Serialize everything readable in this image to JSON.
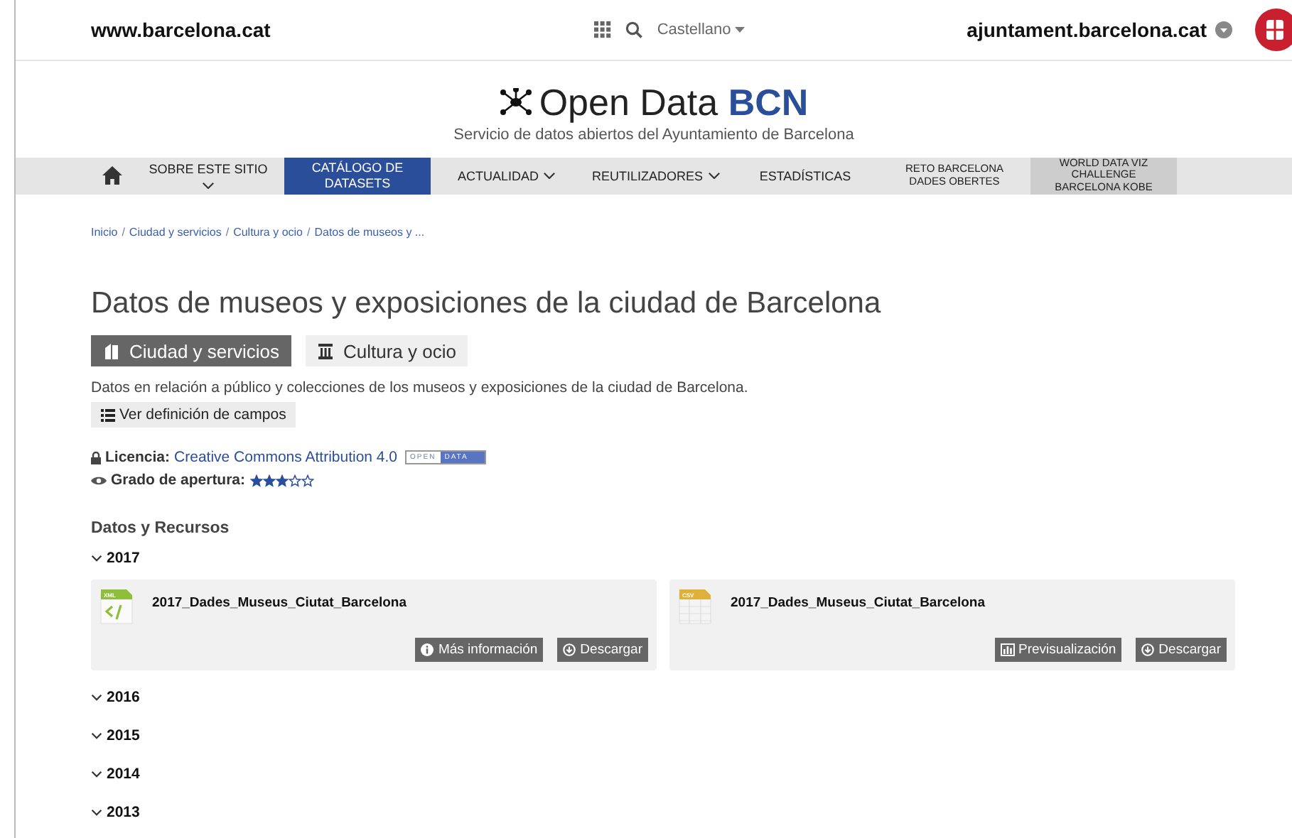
{
  "top_bar": {
    "site": "www.barcelona.cat",
    "language": "Castellano",
    "council": "ajuntament.barcelona.cat"
  },
  "logo": {
    "name": "Open Data",
    "name_bold": "BCN",
    "subtitle": "Servicio de datos abiertos del Ayuntamiento de Barcelona"
  },
  "nav": [
    {
      "label": "SOBRE ESTE SITIO",
      "dropdown": true,
      "selected": false,
      "kind": "stacked"
    },
    {
      "label": "CATÁLOGO DE DATASETS",
      "dropdown": false,
      "selected": true,
      "kind": "normal"
    },
    {
      "label": "ACTUALIDAD",
      "dropdown": true,
      "selected": false,
      "kind": "normal"
    },
    {
      "label": "REUTILIZADORES",
      "dropdown": true,
      "selected": false,
      "kind": "normal"
    },
    {
      "label": "ESTADÍSTICAS",
      "dropdown": false,
      "selected": false,
      "kind": "normal"
    },
    {
      "label": "RETO BARCELONA DADES OBERTES",
      "dropdown": false,
      "selected": false,
      "kind": "small"
    },
    {
      "label": "WORLD DATA VIZ CHALLENGE BARCELONA KOBE",
      "dropdown": false,
      "selected": false,
      "kind": "highlight"
    }
  ],
  "breadcrumb": [
    {
      "kind": "link",
      "text": "Inicio"
    },
    {
      "kind": "separator",
      "text": "/"
    },
    {
      "kind": "link",
      "text": "Ciudad y servicios"
    },
    {
      "kind": "separator",
      "text": "/"
    },
    {
      "kind": "link",
      "text": "Cultura y ocio"
    },
    {
      "kind": "separator",
      "text": "/"
    },
    {
      "kind": "link",
      "text": "Datos de museos y ..."
    }
  ],
  "title": "Datos de museos y exposiciones de la ciudad de Barcelona",
  "categories": [
    {
      "label": "Ciudad y servicios",
      "selected": true
    },
    {
      "label": "Cultura y ocio",
      "selected": false
    }
  ],
  "description": "Datos en relación a público y colecciones de los museos y exposiciones de la ciudad de Barcelona.",
  "fields_button": "Ver definición de campos",
  "license": {
    "label": "Licencia:",
    "value": "Creative Commons Attribution 4.0",
    "badge_left": "OPEN",
    "badge_right": "DATA"
  },
  "openness": {
    "label": "Grado de apertura:",
    "stars": 3
  },
  "resources": {
    "heading": "Datos y Recursos",
    "years": [
      {
        "label": "2017",
        "files": [
          {
            "format": "XML",
            "name": "2017_Dades_Museus_Ciutat_Barcelona",
            "buttons": [
              {
                "kind": "info",
                "label": "Más información"
              },
              {
                "kind": "download",
                "label": "Descargar"
              }
            ]
          },
          {
            "format": "CSV",
            "name": "2017_Dades_Museus_Ciutat_Barcelona",
            "buttons": [
              {
                "kind": "preview",
                "label": "Previsualización"
              },
              {
                "kind": "download",
                "label": "Descargar"
              }
            ]
          }
        ]
      },
      {
        "label": "2016"
      },
      {
        "label": "2015"
      },
      {
        "label": "2014"
      },
      {
        "label": "2013"
      }
    ]
  }
}
